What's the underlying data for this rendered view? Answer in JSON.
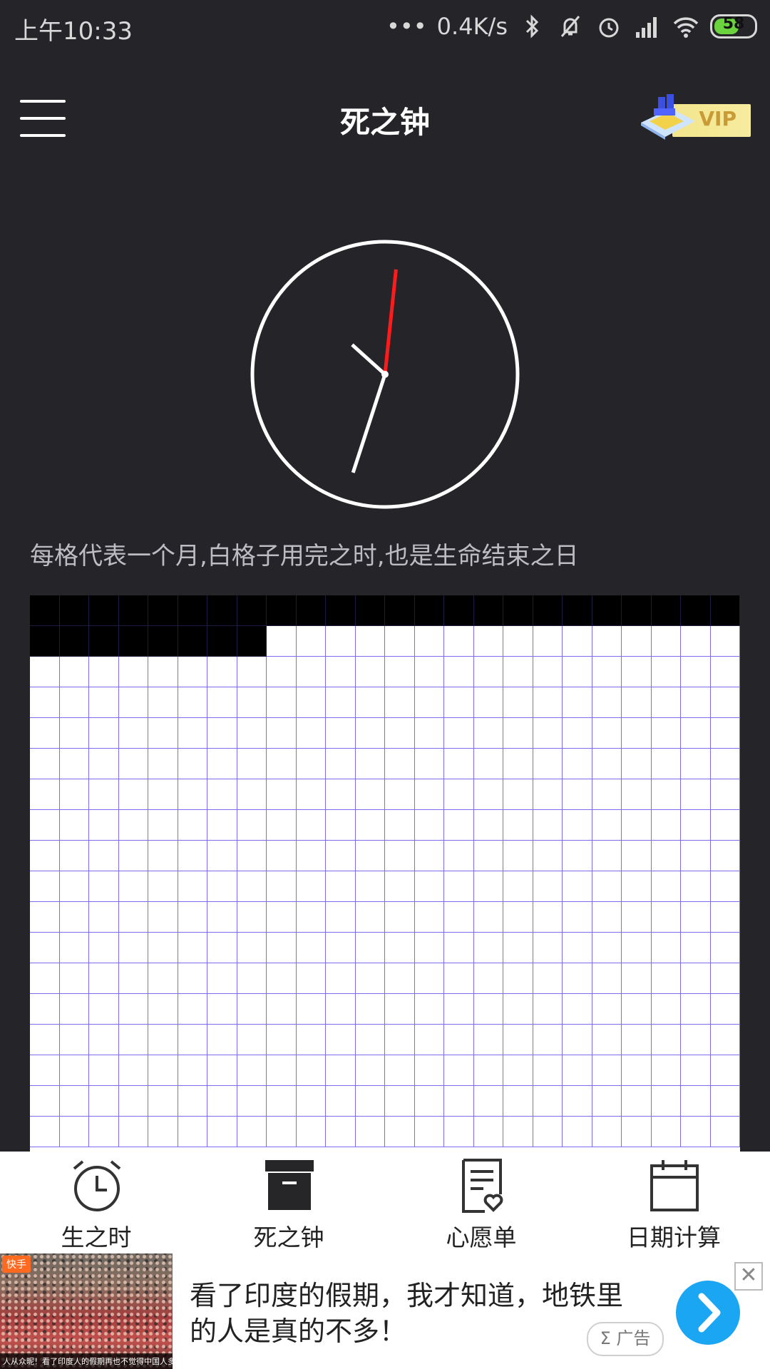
{
  "status_bar": {
    "time": "上午10:33",
    "net_speed": "0.4K/s",
    "battery": "58"
  },
  "header": {
    "title": "死之钟",
    "vip_label": "VIP"
  },
  "clock": {
    "hour_hand_deg": -48,
    "minute_hand_deg": 198,
    "second_hand_deg": 6
  },
  "caption": "每格代表一个月,白格子用完之时,也是生命结束之日",
  "grid": {
    "columns": 24,
    "visible_rows": 18,
    "used_months": 32,
    "used_color": "#000000",
    "line_color": "#7b6cf0"
  },
  "bottom_nav": {
    "items": [
      {
        "label": "生之时",
        "icon": "alarm-clock-icon"
      },
      {
        "label": "死之钟",
        "icon": "archive-box-icon"
      },
      {
        "label": "心愿单",
        "icon": "wish-list-icon"
      },
      {
        "label": "日期计算",
        "icon": "calendar-icon"
      }
    ]
  },
  "ad": {
    "text": "看了印度的假期，我才知道，地铁里的人是真的不多！",
    "badge": "快手",
    "image_caption": "人从众昵！看了印度人的假期再也不觉得中国人多了！",
    "tag": "Σ 广告",
    "close": "✕"
  }
}
